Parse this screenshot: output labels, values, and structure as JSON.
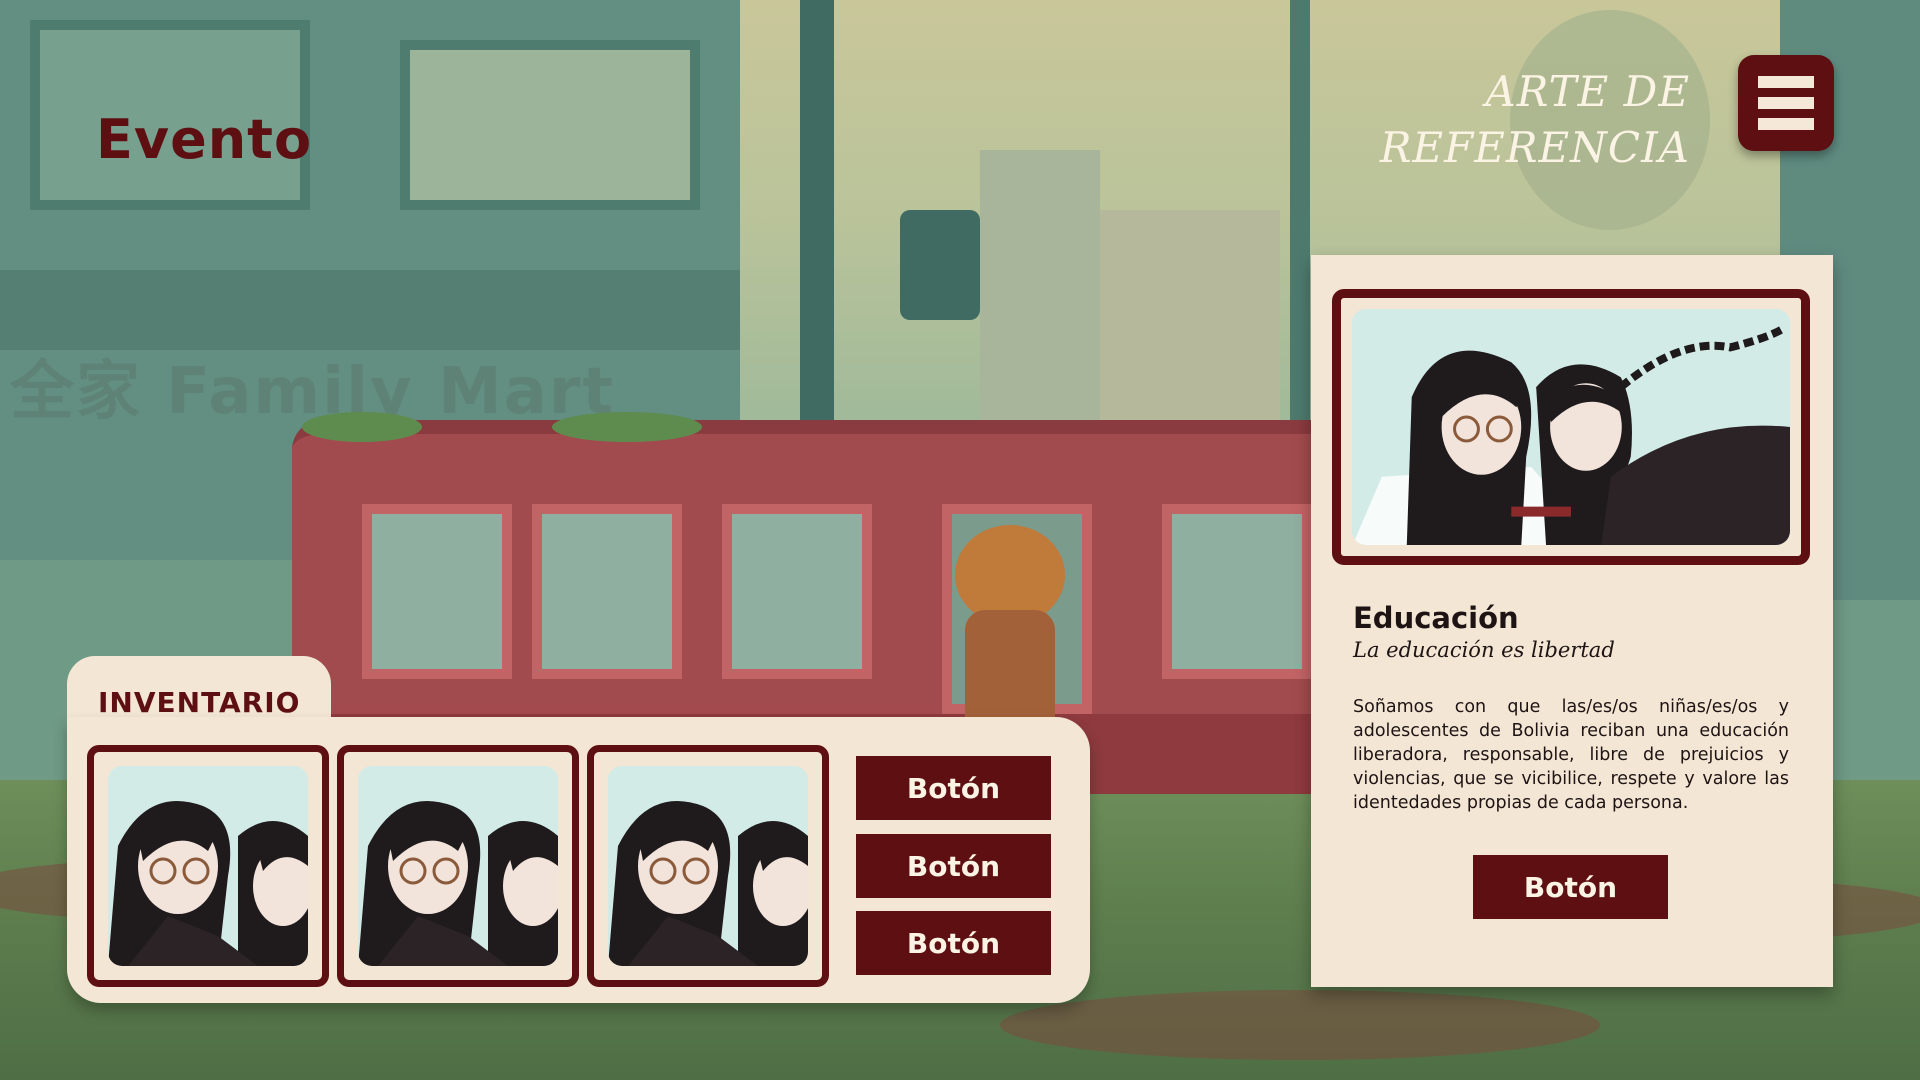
{
  "hud": {
    "event_title": "Evento",
    "reference_title_line1": "ARTE DE",
    "reference_title_line2": "REFERENCIA",
    "menu_icon": "hamburger-menu-icon"
  },
  "background": {
    "sign_text": "全家 Family Mart"
  },
  "inventory": {
    "label": "INVENTARIO",
    "slots": [
      {
        "icon": "character-portrait"
      },
      {
        "icon": "character-portrait"
      },
      {
        "icon": "character-portrait"
      }
    ],
    "buttons": [
      "Botón",
      "Botón",
      "Botón"
    ]
  },
  "card": {
    "title": "Educación",
    "subtitle": "La educación es libertad",
    "body": "Soñamos con que las/es/os niñas/es/os y adolescentes de Bolivia reciban una educación liberadora, responsable, libre de prejuicios y violencias, que se vicibilice, respete y valore las identedades propias de cada persona.",
    "button_label": "Botón"
  },
  "colors": {
    "primary": "#5e0f12",
    "panel": "#f3e6d4",
    "art_bg": "#d3ebe6"
  }
}
